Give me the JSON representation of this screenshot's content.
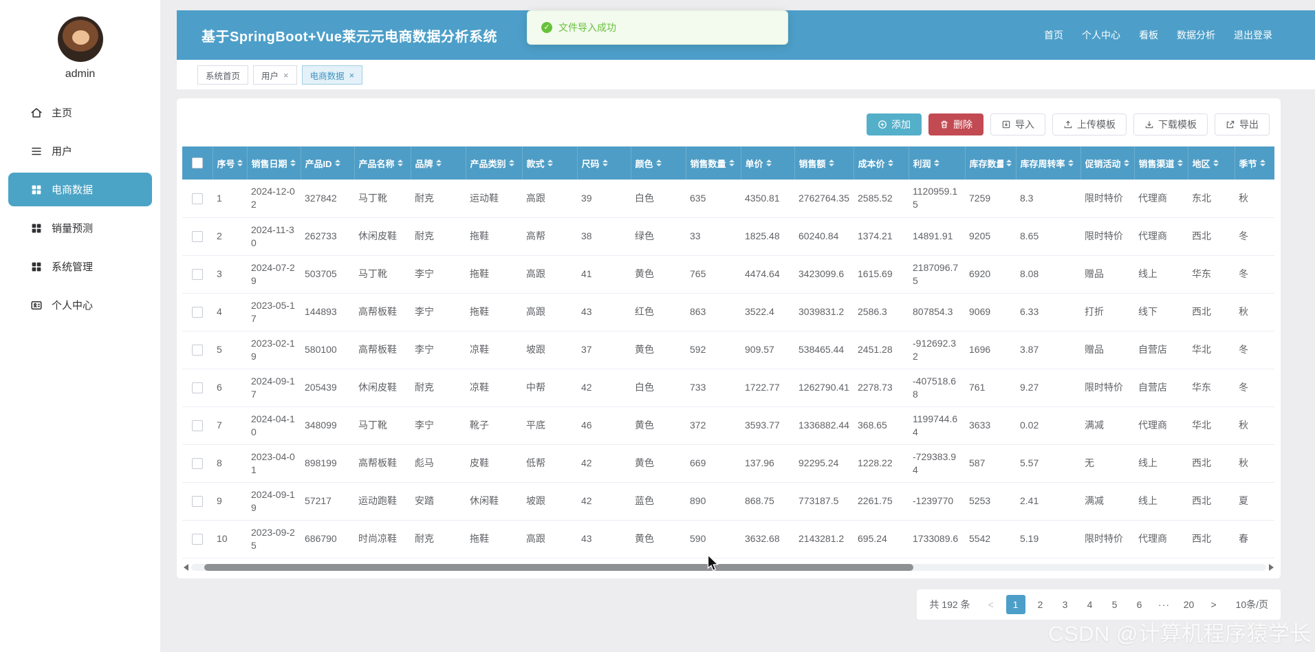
{
  "app": {
    "title": "基于SpringBoot+Vue莱元元电商数据分析系统"
  },
  "theme": {
    "primary": "#4D9FC9",
    "table_header": "#4E9DC6",
    "sidebar_active": "#4BA4C6",
    "add_button": "#54AFC9",
    "delete_button": "#C24A52",
    "success": "#67C23A",
    "pagination_active": "#4D9FC9"
  },
  "toast": {
    "message": "文件导入成功"
  },
  "topnav": {
    "links": [
      {
        "id": "home",
        "label": "首页"
      },
      {
        "id": "personal-center",
        "label": "个人中心"
      },
      {
        "id": "board",
        "label": "看板"
      },
      {
        "id": "data-analysis",
        "label": "数据分析"
      },
      {
        "id": "logout",
        "label": "退出登录"
      }
    ]
  },
  "sidebar": {
    "username": "admin",
    "items": [
      {
        "id": "home",
        "label": "主页",
        "icon": "home-icon",
        "active": false
      },
      {
        "id": "users",
        "label": "用户",
        "icon": "list-icon",
        "active": false
      },
      {
        "id": "ecommerce-data",
        "label": "电商数据",
        "icon": "grid-icon",
        "active": true
      },
      {
        "id": "sales-forecast",
        "label": "销量预测",
        "icon": "grid-icon",
        "active": false
      },
      {
        "id": "system-management",
        "label": "系统管理",
        "icon": "grid-icon",
        "active": false
      },
      {
        "id": "personal-center",
        "label": "个人中心",
        "icon": "idcard-icon",
        "active": false
      }
    ]
  },
  "tabs": [
    {
      "id": "system-home",
      "label": "系统首页",
      "closable": false,
      "active": false
    },
    {
      "id": "users",
      "label": "用户",
      "closable": true,
      "active": false
    },
    {
      "id": "ecommerce-data",
      "label": "电商数据",
      "closable": true,
      "active": true
    }
  ],
  "toolbar": {
    "add": "添加",
    "delete": "删除",
    "import": "导入",
    "upload_template": "上传模板",
    "download_template": "下载模板",
    "export": "导出"
  },
  "table": {
    "columns": [
      "序号",
      "销售日期",
      "产品ID",
      "产品名称",
      "品牌",
      "产品类别",
      "款式",
      "尺码",
      "颜色",
      "销售数量",
      "单价",
      "销售额",
      "成本价",
      "利润",
      "库存数量",
      "库存周转率",
      "促销活动",
      "销售渠道",
      "地区",
      "季节"
    ],
    "rows": [
      [
        "1",
        "2024-12-02",
        "327842",
        "马丁靴",
        "耐克",
        "运动鞋",
        "高跟",
        "39",
        "白色",
        "635",
        "4350.81",
        "2762764.35",
        "2585.52",
        "1120959.15",
        "7259",
        "8.3",
        "限时特价",
        "代理商",
        "东北",
        "秋"
      ],
      [
        "2",
        "2024-11-30",
        "262733",
        "休闲皮鞋",
        "耐克",
        "拖鞋",
        "高帮",
        "38",
        "绿色",
        "33",
        "1825.48",
        "60240.84",
        "1374.21",
        "14891.91",
        "9205",
        "8.65",
        "限时特价",
        "代理商",
        "西北",
        "冬"
      ],
      [
        "3",
        "2024-07-29",
        "503705",
        "马丁靴",
        "李宁",
        "拖鞋",
        "高跟",
        "41",
        "黄色",
        "765",
        "4474.64",
        "3423099.6",
        "1615.69",
        "2187096.75",
        "6920",
        "8.08",
        "赠品",
        "线上",
        "华东",
        "冬"
      ],
      [
        "4",
        "2023-05-17",
        "144893",
        "高帮板鞋",
        "李宁",
        "拖鞋",
        "高跟",
        "43",
        "红色",
        "863",
        "3522.4",
        "3039831.2",
        "2586.3",
        "807854.3",
        "9069",
        "6.33",
        "打折",
        "线下",
        "西北",
        "秋"
      ],
      [
        "5",
        "2023-02-19",
        "580100",
        "高帮板鞋",
        "李宁",
        "凉鞋",
        "坡跟",
        "37",
        "黄色",
        "592",
        "909.57",
        "538465.44",
        "2451.28",
        "-912692.32",
        "1696",
        "3.87",
        "赠品",
        "自营店",
        "华北",
        "冬"
      ],
      [
        "6",
        "2024-09-17",
        "205439",
        "休闲皮鞋",
        "耐克",
        "凉鞋",
        "中帮",
        "42",
        "白色",
        "733",
        "1722.77",
        "1262790.41",
        "2278.73",
        "-407518.68",
        "761",
        "9.27",
        "限时特价",
        "自营店",
        "华东",
        "冬"
      ],
      [
        "7",
        "2024-04-10",
        "348099",
        "马丁靴",
        "李宁",
        "靴子",
        "平底",
        "46",
        "黄色",
        "372",
        "3593.77",
        "1336882.44",
        "368.65",
        "1199744.64",
        "3633",
        "0.02",
        "满减",
        "代理商",
        "华北",
        "秋"
      ],
      [
        "8",
        "2023-04-01",
        "898199",
        "高帮板鞋",
        "彪马",
        "皮鞋",
        "低帮",
        "42",
        "黄色",
        "669",
        "137.96",
        "92295.24",
        "1228.22",
        "-729383.94",
        "587",
        "5.57",
        "无",
        "线上",
        "西北",
        "秋"
      ],
      [
        "9",
        "2024-09-19",
        "57217",
        "运动跑鞋",
        "安踏",
        "休闲鞋",
        "坡跟",
        "42",
        "蓝色",
        "890",
        "868.75",
        "773187.5",
        "2261.75",
        "-1239770",
        "5253",
        "2.41",
        "满减",
        "线上",
        "西北",
        "夏"
      ],
      [
        "10",
        "2023-09-25",
        "686790",
        "时尚凉鞋",
        "耐克",
        "拖鞋",
        "高跟",
        "43",
        "黄色",
        "590",
        "3632.68",
        "2143281.2",
        "695.24",
        "1733089.6",
        "5542",
        "5.19",
        "限时特价",
        "代理商",
        "西北",
        "春"
      ]
    ]
  },
  "scrollbar": {
    "thumb_left_pct": 1.2,
    "thumb_width_pct": 66
  },
  "pagination": {
    "total": "共 192 条",
    "prev": "<",
    "pages": [
      "1",
      "2",
      "3",
      "4",
      "5",
      "6"
    ],
    "ellipsis": "···",
    "last_page": "20",
    "next": ">",
    "active_page": "1",
    "page_size": "10条/页"
  },
  "watermark": "CSDN @计算机程序猿学长"
}
